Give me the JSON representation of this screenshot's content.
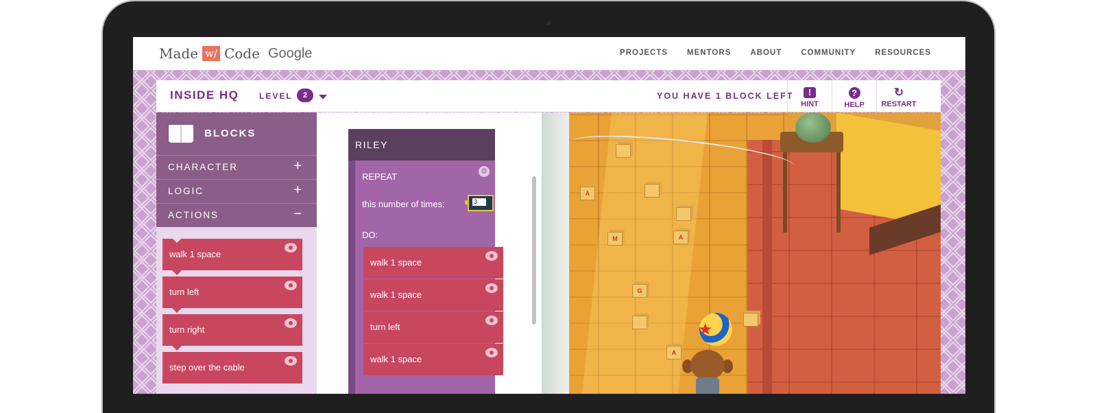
{
  "site": {
    "logo": {
      "made": "Made",
      "w": "w/",
      "code": "Code",
      "google": "Google"
    },
    "nav": [
      "PROJECTS",
      "MENTORS",
      "ABOUT",
      "COMMUNITY",
      "RESOURCES"
    ]
  },
  "game": {
    "title": "INSIDE HQ",
    "level_label": "LEVEL",
    "level_value": "2",
    "blocks_left": "YOU HAVE 1 BLOCK LEFT",
    "buttons": {
      "hint": "HINT",
      "help": "HELP",
      "restart": "RESTART"
    }
  },
  "palette": {
    "title": "BLOCKS",
    "categories": [
      {
        "label": "CHARACTER",
        "sign": "+"
      },
      {
        "label": "LOGIC",
        "sign": "+"
      },
      {
        "label": "ACTIONS",
        "sign": "−"
      }
    ],
    "actions": [
      "walk 1 space",
      "turn left",
      "turn right",
      "step over the cable"
    ]
  },
  "workspace": {
    "character": "RILEY",
    "repeat": {
      "title": "REPEAT",
      "times_label": "this number of times:",
      "times_value": "3",
      "do_label": "DO:"
    },
    "do_blocks": [
      "walk 1 space",
      "walk 1 space",
      "turn left",
      "walk 1 space"
    ]
  },
  "scene": {
    "blocks_letters": [
      "A",
      "A",
      "M",
      "A",
      "G"
    ]
  },
  "colors": {
    "accent": "#7b2b8a",
    "action_block": "#c9465f",
    "repeat_block": "#a265a8",
    "character_block": "#5a3f5e"
  }
}
